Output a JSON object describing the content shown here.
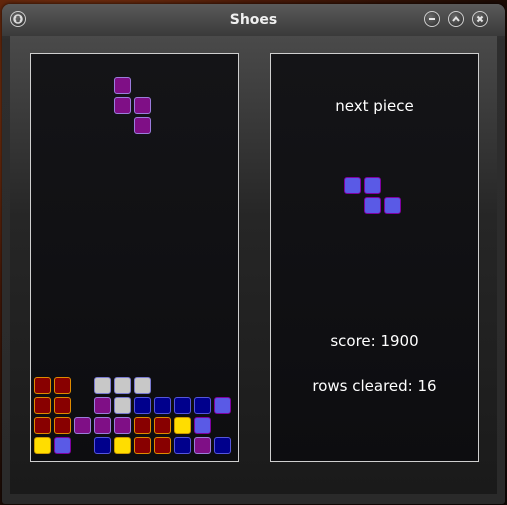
{
  "window": {
    "title": "Shoes"
  },
  "titlebar": {
    "left_icon": "menu-circle-icon",
    "buttons": [
      "minimize-icon",
      "maximize-icon",
      "close-icon"
    ]
  },
  "colors": {
    "dark_red": {
      "fill": "#880000",
      "border": "#e08a00"
    },
    "gray": {
      "fill": "#c8c8c8",
      "border": "#7a7ad0"
    },
    "purple": {
      "fill": "#7f0f86",
      "border": "#9c7cdc"
    },
    "navy": {
      "fill": "#00008c",
      "border": "#5555dd"
    },
    "blue": {
      "fill": "#5a5ae6",
      "border": "#7f00a0"
    },
    "yellow": {
      "fill": "#ffdd00",
      "border": "#cc9900"
    }
  },
  "board": {
    "columns": 10,
    "rows": 20,
    "falling_piece": {
      "color": "purple",
      "cells": [
        [
          4,
          1
        ],
        [
          4,
          2
        ],
        [
          5,
          2
        ],
        [
          5,
          3
        ]
      ]
    },
    "stack": [
      [
        0,
        16,
        "dark_red"
      ],
      [
        1,
        16,
        "dark_red"
      ],
      [
        3,
        16,
        "gray"
      ],
      [
        4,
        16,
        "gray"
      ],
      [
        5,
        16,
        "gray"
      ],
      [
        0,
        17,
        "dark_red"
      ],
      [
        1,
        17,
        "dark_red"
      ],
      [
        3,
        17,
        "purple"
      ],
      [
        4,
        17,
        "gray"
      ],
      [
        5,
        17,
        "navy"
      ],
      [
        6,
        17,
        "navy"
      ],
      [
        7,
        17,
        "navy"
      ],
      [
        8,
        17,
        "navy"
      ],
      [
        9,
        17,
        "blue"
      ],
      [
        0,
        18,
        "dark_red"
      ],
      [
        1,
        18,
        "dark_red"
      ],
      [
        2,
        18,
        "purple"
      ],
      [
        3,
        18,
        "purple"
      ],
      [
        4,
        18,
        "purple"
      ],
      [
        5,
        18,
        "dark_red"
      ],
      [
        6,
        18,
        "dark_red"
      ],
      [
        7,
        18,
        "yellow"
      ],
      [
        8,
        18,
        "blue"
      ],
      [
        0,
        19,
        "yellow"
      ],
      [
        1,
        19,
        "blue"
      ],
      [
        3,
        19,
        "navy"
      ],
      [
        4,
        19,
        "yellow"
      ],
      [
        5,
        19,
        "dark_red"
      ],
      [
        6,
        19,
        "dark_red"
      ],
      [
        7,
        19,
        "navy"
      ],
      [
        8,
        19,
        "purple"
      ],
      [
        9,
        19,
        "navy"
      ]
    ]
  },
  "side_panel": {
    "next_label": "next piece",
    "next_piece": {
      "color": "blue",
      "cells": [
        [
          0,
          0
        ],
        [
          1,
          0
        ],
        [
          1,
          1
        ],
        [
          2,
          1
        ]
      ]
    },
    "score_text": "score: 1900",
    "rows_text": "rows cleared: 16"
  }
}
